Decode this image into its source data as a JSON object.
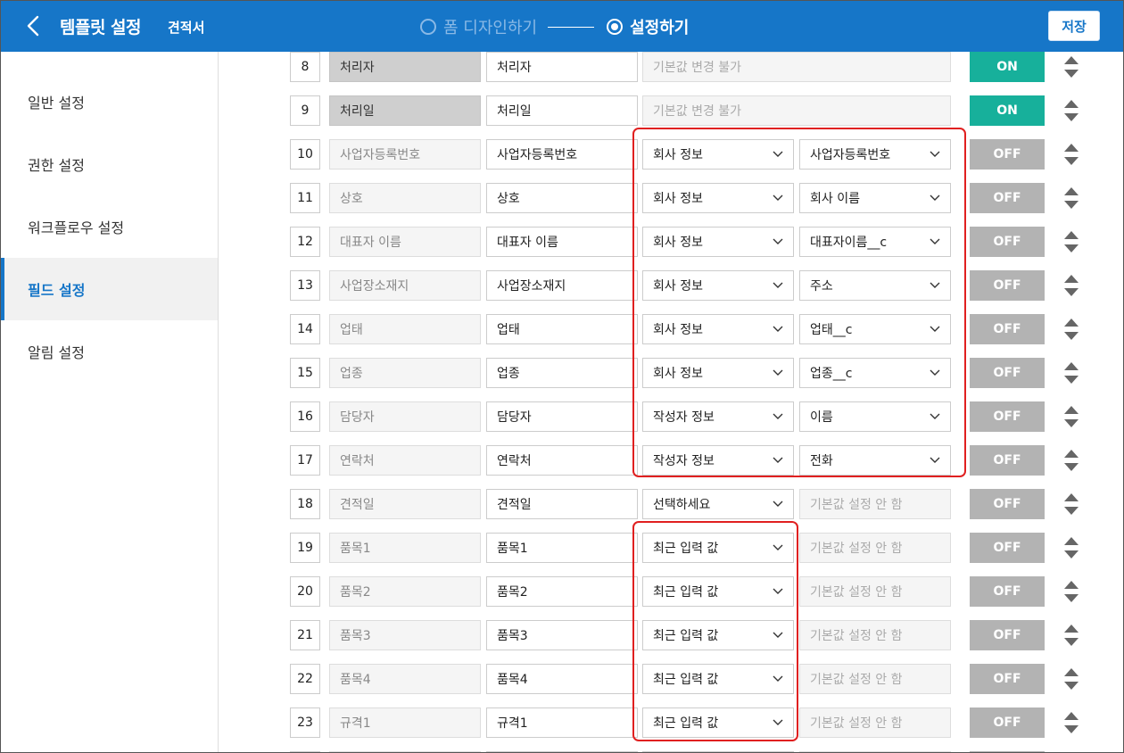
{
  "header": {
    "title": "템플릿 설정",
    "subtitle": "견적서",
    "step1_label": "폼 디자인하기",
    "step2_label": "설정하기",
    "save_label": "저장",
    "bg_color": "#1676c8"
  },
  "sidebar": {
    "items": [
      {
        "label": "일반 설정",
        "active": false
      },
      {
        "label": "권한 설정",
        "active": false
      },
      {
        "label": "워크플로우 설정",
        "active": false
      },
      {
        "label": "필드 설정",
        "active": true
      },
      {
        "label": "알림 설정",
        "active": false
      }
    ]
  },
  "colors": {
    "on": "#17b09b",
    "off": "#b3b3b3",
    "highlight": "#e02020"
  },
  "rows": [
    {
      "num": "8",
      "orig": "처리자",
      "label": "처리자",
      "locked": true,
      "wide": "기본값 변경 불가",
      "toggle": "ON"
    },
    {
      "num": "9",
      "orig": "처리일",
      "label": "처리일",
      "locked": true,
      "wide": "기본값 변경 불가",
      "toggle": "ON"
    },
    {
      "num": "10",
      "orig": "사업자등록번호",
      "label": "사업자등록번호",
      "sel1": "회사 정보",
      "sel2": "사업자등록번호",
      "toggle": "OFF"
    },
    {
      "num": "11",
      "orig": "상호",
      "label": "상호",
      "sel1": "회사 정보",
      "sel2": "회사 이름",
      "toggle": "OFF"
    },
    {
      "num": "12",
      "orig": "대표자 이름",
      "label": "대표자 이름",
      "sel1": "회사 정보",
      "sel2": "대표자이름__c",
      "toggle": "OFF"
    },
    {
      "num": "13",
      "orig": "사업장소재지",
      "label": "사업장소재지",
      "sel1": "회사 정보",
      "sel2": "주소",
      "toggle": "OFF"
    },
    {
      "num": "14",
      "orig": "업태",
      "label": "업태",
      "sel1": "회사 정보",
      "sel2": "업태__c",
      "toggle": "OFF"
    },
    {
      "num": "15",
      "orig": "업종",
      "label": "업종",
      "sel1": "회사 정보",
      "sel2": "업종__c",
      "toggle": "OFF"
    },
    {
      "num": "16",
      "orig": "담당자",
      "label": "담당자",
      "sel1": "작성자 정보",
      "sel2": "이름",
      "toggle": "OFF"
    },
    {
      "num": "17",
      "orig": "연락처",
      "label": "연락처",
      "sel1": "작성자 정보",
      "sel2": "전화",
      "toggle": "OFF"
    },
    {
      "num": "18",
      "orig": "견적일",
      "label": "견적일",
      "sel1": "선택하세요",
      "def": "기본값 설정 안 함",
      "toggle": "OFF"
    },
    {
      "num": "19",
      "orig": "품목1",
      "label": "품목1",
      "sel1": "최근 입력 값",
      "def": "기본값 설정 안 함",
      "toggle": "OFF"
    },
    {
      "num": "20",
      "orig": "품목2",
      "label": "품목2",
      "sel1": "최근 입력 값",
      "def": "기본값 설정 안 함",
      "toggle": "OFF"
    },
    {
      "num": "21",
      "orig": "품목3",
      "label": "품목3",
      "sel1": "최근 입력 값",
      "def": "기본값 설정 안 함",
      "toggle": "OFF"
    },
    {
      "num": "22",
      "orig": "품목4",
      "label": "품목4",
      "sel1": "최근 입력 값",
      "def": "기본값 설정 안 함",
      "toggle": "OFF"
    },
    {
      "num": "23",
      "orig": "규격1",
      "label": "규격1",
      "sel1": "최근 입력 값",
      "def": "기본값 설정 안 함",
      "toggle": "OFF"
    }
  ]
}
